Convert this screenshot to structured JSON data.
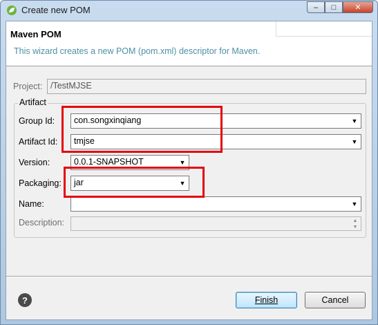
{
  "window": {
    "title": "Create new POM",
    "minimize_label": "–",
    "maximize_label": "□",
    "close_label": "✕"
  },
  "banner": {
    "title": "Maven POM",
    "description": "This wizard creates a new POM (pom.xml) descriptor for Maven."
  },
  "project": {
    "label": "Project:",
    "value": "/TestMJSE"
  },
  "artifact_group": {
    "label": "Artifact",
    "group_id": {
      "label": "Group Id:",
      "value": "con.songxinqiang"
    },
    "artifact_id": {
      "label": "Artifact Id:",
      "value": "tmjse"
    },
    "version": {
      "label": "Version:",
      "value": "0.0.1-SNAPSHOT"
    },
    "packaging": {
      "label": "Packaging:",
      "value": "jar"
    },
    "name": {
      "label": "Name:",
      "value": ""
    },
    "description": {
      "label": "Description:",
      "value": ""
    }
  },
  "footer": {
    "help_symbol": "?",
    "finish_label": "Finish",
    "cancel_label": "Cancel"
  },
  "colors": {
    "highlight_red": "#e3040a",
    "banner_text": "#4d8fa6",
    "window_frame": "#c9dcef"
  }
}
